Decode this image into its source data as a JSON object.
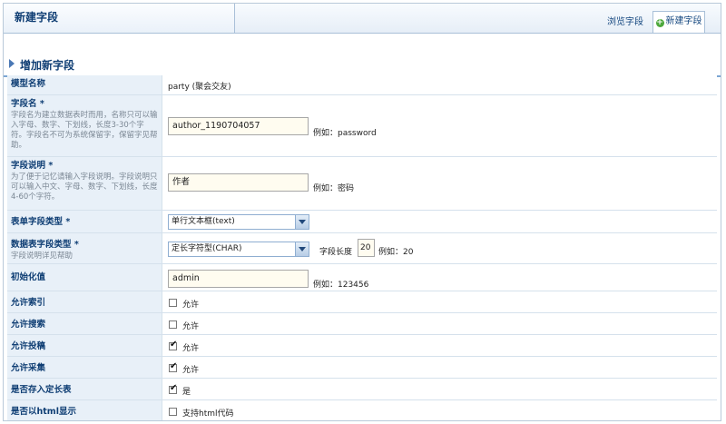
{
  "header": {
    "title": "新建字段",
    "tabs": [
      {
        "label": "浏览字段"
      },
      {
        "label": "新建字段"
      }
    ]
  },
  "section": {
    "title": "增加新字段"
  },
  "rows": {
    "model_name": {
      "label": "模型名称",
      "value": "party (聚会交友)"
    },
    "field_name": {
      "label": "字段名",
      "required": "*",
      "desc": "字段名为建立数据表时而用，名称只可以输入字母、数字、下划线，长度3-30个字符。字段名不可为系统保留字，保留字见帮助。",
      "value": "author_1190704057",
      "example": "例如：password"
    },
    "field_desc": {
      "label": "字段说明",
      "required": "*",
      "desc": "为了便于记忆请输入字段说明。字段说明只可以输入中文、字母、数字、下划线，长度4-60个字符。",
      "value": "作者",
      "example": "例如：密码"
    },
    "form_type": {
      "label": "表单字段类型",
      "required": "*",
      "selected": "单行文本框(text)"
    },
    "db_type": {
      "label": "数据表字段类型",
      "required": "*",
      "desc": "字段说明详见帮助",
      "selected": "定长字符型(CHAR)",
      "length_label": "字段长度",
      "length_value": "20",
      "example": "例如：20"
    },
    "init_value": {
      "label": "初始化值",
      "value": "admin",
      "example": "例如：123456"
    },
    "allow_index": {
      "label": "允许索引",
      "option": "允许",
      "checked": false
    },
    "allow_search": {
      "label": "允许搜索",
      "option": "允许",
      "checked": false
    },
    "allow_submit": {
      "label": "允许投稿",
      "option": "允许",
      "checked": true
    },
    "allow_collect": {
      "label": "允许采集",
      "option": "允许",
      "checked": true
    },
    "fixed_table": {
      "label": "是否存入定长表",
      "option": "是",
      "checked": true
    },
    "html_display": {
      "label": "是否以html显示",
      "option": "支持html代码",
      "checked": false
    }
  }
}
